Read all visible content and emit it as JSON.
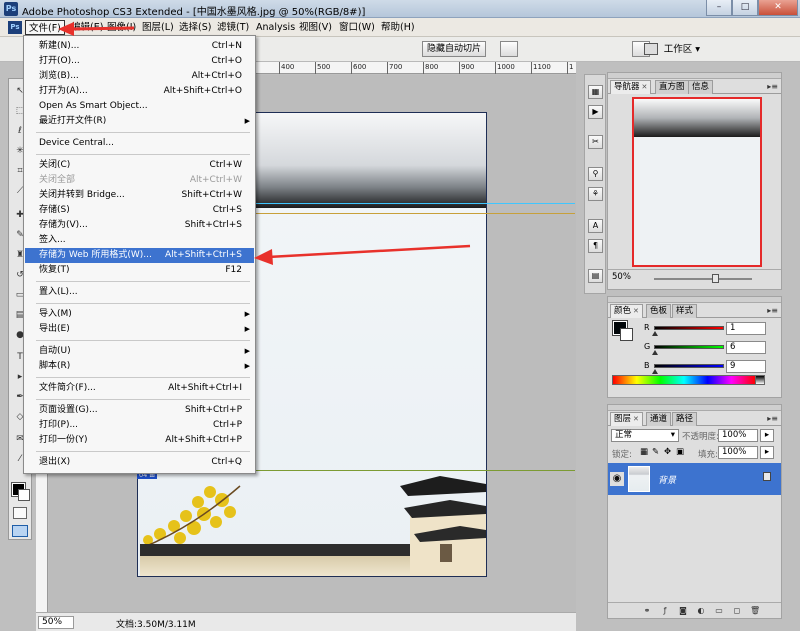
{
  "window": {
    "title": "Adobe Photoshop CS3 Extended - [中国水墨风格.jpg @ 50%(RGB/8#)]",
    "app_badge": "Ps",
    "buttons": [
      "–",
      "□",
      "✕"
    ]
  },
  "menubar": {
    "items": [
      "文件(F)",
      "编辑(E)",
      "图像(I)",
      "图层(L)",
      "选择(S)",
      "滤镜(T)",
      "Analysis",
      "视图(V)",
      "窗口(W)",
      "帮助(H)"
    ]
  },
  "options_bar": {
    "hide_slices_button": "隐藏自动切片",
    "workspace_label": "工作区 ▾"
  },
  "ruler": {
    "ticks": [
      "400",
      "500",
      "600",
      "700",
      "800",
      "900",
      "1000",
      "1100",
      "1200",
      "1300",
      "1400",
      "1"
    ]
  },
  "document": {
    "slice_label": "04 ⊞"
  },
  "file_menu": {
    "items": [
      {
        "label": "新建(N)...",
        "shortcut": "Ctrl+N"
      },
      {
        "label": "打开(O)...",
        "shortcut": "Ctrl+O"
      },
      {
        "label": "浏览(B)...",
        "shortcut": "Alt+Ctrl+O"
      },
      {
        "label": "打开为(A)...",
        "shortcut": "Alt+Shift+Ctrl+O"
      },
      {
        "label": "Open As Smart Object...",
        "shortcut": ""
      },
      {
        "label": "最近打开文件(R)",
        "shortcut": "",
        "submenu": true
      },
      {
        "label": "Device Central...",
        "shortcut": ""
      },
      {
        "label": "关闭(C)",
        "shortcut": "Ctrl+W"
      },
      {
        "label": "关闭全部",
        "shortcut": "Alt+Ctrl+W",
        "disabled": true
      },
      {
        "label": "关闭并转到 Bridge...",
        "shortcut": "Shift+Ctrl+W"
      },
      {
        "label": "存储(S)",
        "shortcut": "Ctrl+S"
      },
      {
        "label": "存储为(V)...",
        "shortcut": "Shift+Ctrl+S"
      },
      {
        "label": "签入...",
        "shortcut": "",
        "disabled": true
      },
      {
        "label": "存储为 Web 所用格式(W)...",
        "shortcut": "Alt+Shift+Ctrl+S",
        "highlighted": true
      },
      {
        "label": "恢复(T)",
        "shortcut": "F12"
      },
      {
        "label": "置入(L)...",
        "shortcut": ""
      },
      {
        "label": "导入(M)",
        "shortcut": "",
        "submenu": true
      },
      {
        "label": "导出(E)",
        "shortcut": "",
        "submenu": true
      },
      {
        "label": "自动(U)",
        "shortcut": "",
        "submenu": true
      },
      {
        "label": "脚本(R)",
        "shortcut": "",
        "submenu": true
      },
      {
        "label": "文件简介(F)...",
        "shortcut": "Alt+Shift+Ctrl+I"
      },
      {
        "label": "页面设置(G)...",
        "shortcut": "Shift+Ctrl+P"
      },
      {
        "label": "打印(P)...",
        "shortcut": "Ctrl+P"
      },
      {
        "label": "打印一份(Y)",
        "shortcut": "Alt+Shift+Ctrl+P"
      },
      {
        "label": "退出(X)",
        "shortcut": "Ctrl+Q"
      }
    ]
  },
  "navigator_panel": {
    "tabs": [
      "导航器",
      "直方图",
      "信息"
    ],
    "zoom": "50%"
  },
  "color_panel": {
    "tabs": [
      "颜色",
      "色板",
      "样式"
    ],
    "channels": [
      {
        "name": "R",
        "value": "1"
      },
      {
        "name": "G",
        "value": "6"
      },
      {
        "name": "B",
        "value": "9"
      }
    ]
  },
  "layers_panel": {
    "tabs": [
      "图层",
      "通道",
      "路径"
    ],
    "blend_mode": "正常",
    "opacity_label": "不透明度:",
    "opacity_value": "100%",
    "lock_label": "锁定:",
    "fill_label": "填充:",
    "fill_value": "100%",
    "layer_name": "背景"
  },
  "status_bar": {
    "zoom": "50%",
    "doc_info": "文档:3.50M/3.11M"
  },
  "colors": {
    "highlight": "#3d73cf",
    "annotation_red": "#e8312b"
  }
}
